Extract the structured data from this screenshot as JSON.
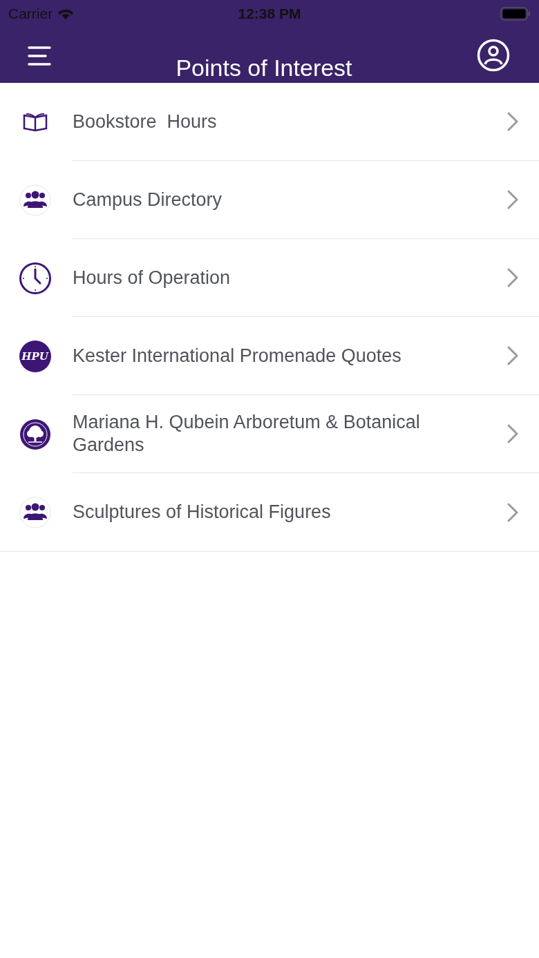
{
  "status_bar": {
    "carrier": "Carrier",
    "time": "12:38 PM"
  },
  "nav_bar": {
    "title": "Points of Interest"
  },
  "items": [
    {
      "label": "Bookstore  Hours",
      "kind": "book"
    },
    {
      "label": "Campus Directory",
      "kind": "people"
    },
    {
      "label": "Hours of Operation",
      "kind": "clock"
    },
    {
      "label": "Kester International Promenade Quotes",
      "kind": "logo",
      "logo_text": "HPU"
    },
    {
      "label": "Mariana H. Qubein Arboretum & Botanical Gardens",
      "kind": "tree"
    },
    {
      "label": "Sculptures of Historical Figures",
      "kind": "people"
    }
  ]
}
